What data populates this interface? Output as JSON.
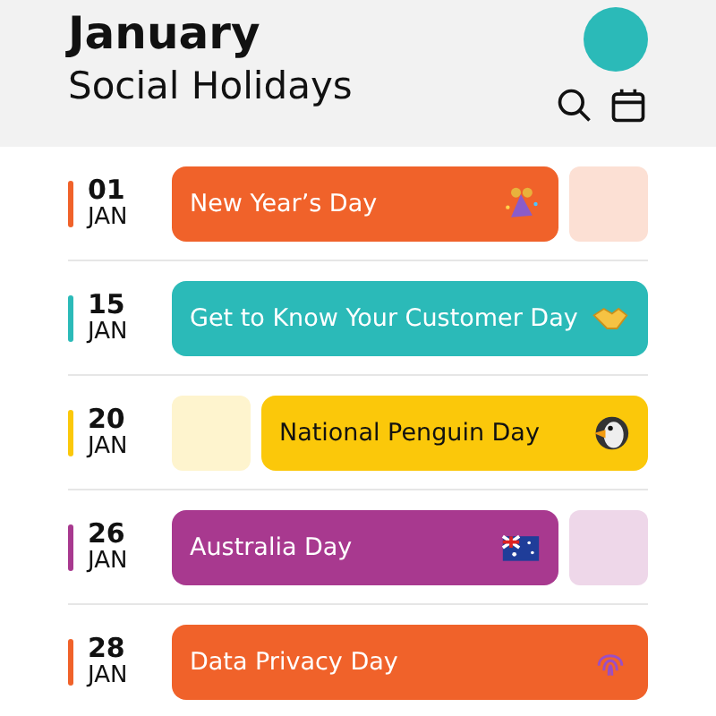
{
  "header": {
    "title": "January",
    "subtitle": "Social Holidays"
  },
  "days": [
    {
      "day": "01",
      "month": "JAN",
      "color": "#f0622a",
      "events": [
        {
          "kind": "event",
          "title": "New Year’s Day"
        },
        {
          "kind": "ghost"
        }
      ]
    },
    {
      "day": "15",
      "month": "JAN",
      "color": "#2bbab8",
      "events": [
        {
          "kind": "event",
          "title": "Get to Know Your Customer Day"
        }
      ]
    },
    {
      "day": "20",
      "month": "JAN",
      "color": "#fbc80a",
      "events": [
        {
          "kind": "ghost"
        },
        {
          "kind": "event",
          "title": "National Penguin Day"
        }
      ]
    },
    {
      "day": "26",
      "month": "JAN",
      "color": "#a8398f",
      "events": [
        {
          "kind": "event",
          "title": "Australia Day"
        },
        {
          "kind": "ghost"
        }
      ]
    },
    {
      "day": "28",
      "month": "JAN",
      "color": "#f0622a",
      "events": [
        {
          "kind": "event",
          "title": "Data Privacy Day"
        }
      ]
    }
  ]
}
